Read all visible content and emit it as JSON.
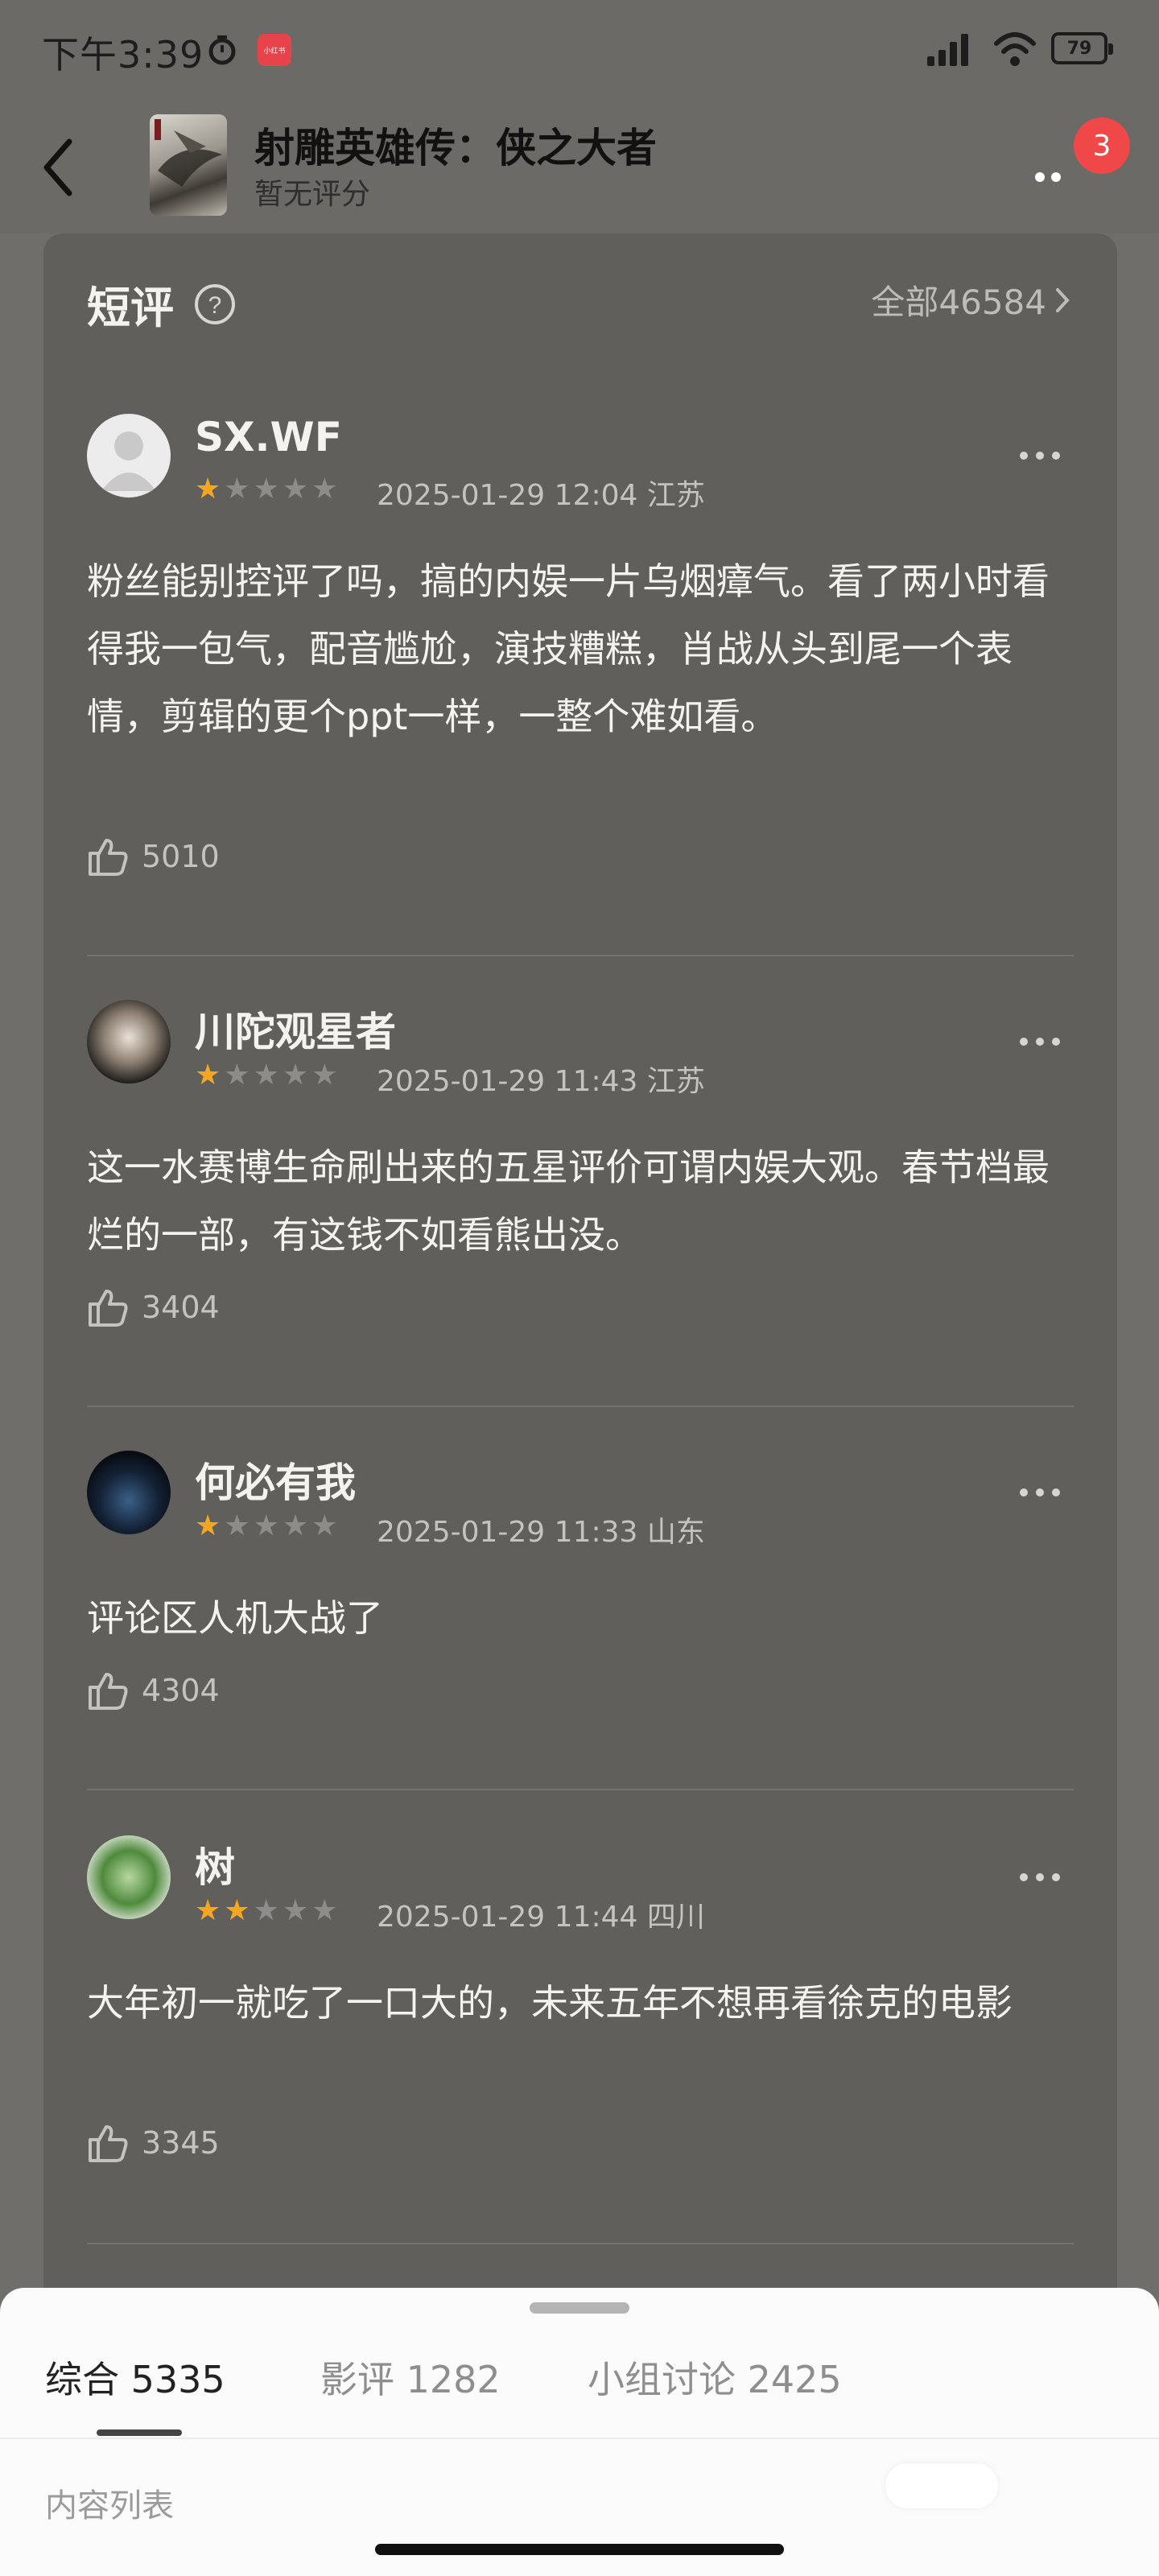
{
  "status_bar": {
    "time": "下午3:39",
    "app_icon_text": "小红书",
    "battery": "79",
    "icons": [
      "clock-icon",
      "signal-icon",
      "wifi-icon",
      "battery-icon"
    ]
  },
  "nav": {
    "title": "射雕英雄传：侠之大者",
    "subtitle": "暂无评分",
    "badge": "3",
    "icons": [
      "back-arrow-icon",
      "more-dots-icon"
    ]
  },
  "section": {
    "title": "短评",
    "view_all": "全部46584"
  },
  "reviews": [
    {
      "username": "SX.WF",
      "rating": 1,
      "meta": "2025-01-29 12:04 江苏",
      "text": "粉丝能别控评了吗，搞的内娱一片乌烟瘴气。看了两小时看得我一包气，配音尴尬，演技糟糕，肖战从头到尾一个表情，剪辑的更个ppt一样，一整个难如看。",
      "likes": "5010"
    },
    {
      "username": "川陀观星者",
      "rating": 1,
      "meta": "2025-01-29 11:43 江苏",
      "text": "这一水赛博生命刷出来的五星评价可谓内娱大观。春节档最烂的一部，有这钱不如看熊出没。",
      "likes": "3404"
    },
    {
      "username": "何必有我",
      "rating": 1,
      "meta": "2025-01-29 11:33 山东",
      "text": "评论区人机大战了",
      "likes": "4304"
    },
    {
      "username": "树",
      "rating": 2,
      "meta": "2025-01-29 11:44 四川",
      "text": "大年初一就吃了一口大的，未来五年不想再看徐克的电影",
      "likes": "3345"
    }
  ],
  "bottom_sheet": {
    "tabs": [
      {
        "label": "综合 5335",
        "active": true
      },
      {
        "label": "影评 1282",
        "active": false
      },
      {
        "label": "小组讨论 2425",
        "active": false
      }
    ],
    "content_label": "内容列表"
  },
  "colors": {
    "background": "#6f6e6a",
    "card": "#605f5b",
    "star": "#f5a623",
    "badge": "#f04848"
  }
}
